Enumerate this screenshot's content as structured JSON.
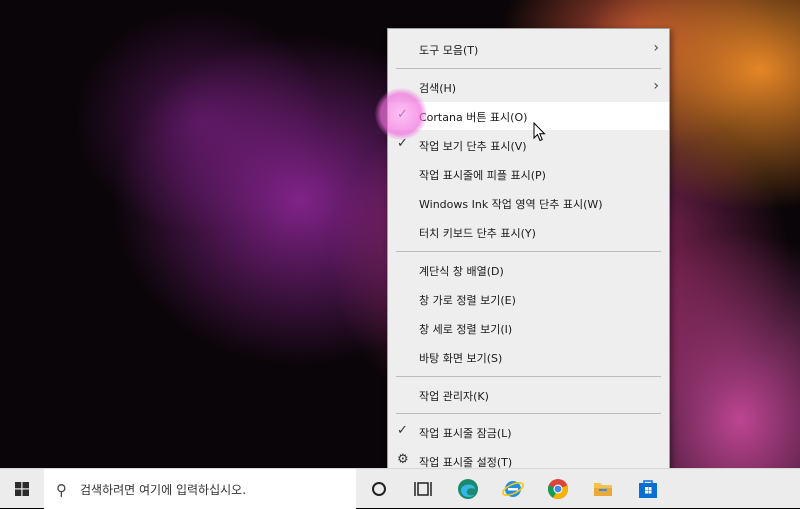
{
  "context_menu": {
    "items": [
      {
        "label": "도구 모음(T)",
        "submenu": true
      },
      {
        "label": "검색(H)",
        "submenu": true
      },
      {
        "label": "Cortana 버튼 표시(O)",
        "checked": true,
        "highlighted": true
      },
      {
        "label": "작업 보기 단추 표시(V)",
        "checked": true
      },
      {
        "label": "작업 표시줄에 피플 표시(P)"
      },
      {
        "label": "Windows Ink 작업 영역 단추 표시(W)"
      },
      {
        "label": "터치 키보드 단추 표시(Y)"
      },
      {
        "label": "계단식 창 배열(D)"
      },
      {
        "label": "창 가로 정렬 보기(E)"
      },
      {
        "label": "창 세로 정렬 보기(I)"
      },
      {
        "label": "바탕 화면 보기(S)"
      },
      {
        "label": "작업 관리자(K)"
      },
      {
        "label": "작업 표시줄 잠금(L)",
        "checked": true
      },
      {
        "label": "작업 표시줄 설정(T)",
        "icon": "gear-icon"
      }
    ]
  },
  "taskbar": {
    "search_placeholder": "검색하려면 여기에 입력하십시오.",
    "icons": [
      "windows-start-icon",
      "cortana-icon",
      "task-view-icon",
      "edge-icon",
      "internet-explorer-icon",
      "chrome-icon",
      "file-explorer-icon",
      "store-icon"
    ]
  },
  "colors": {
    "menu_bg": "#eeeeee",
    "highlight_bg": "#ffffff",
    "taskbar_bg": "#ececec",
    "click_ring": "#f080dc"
  }
}
